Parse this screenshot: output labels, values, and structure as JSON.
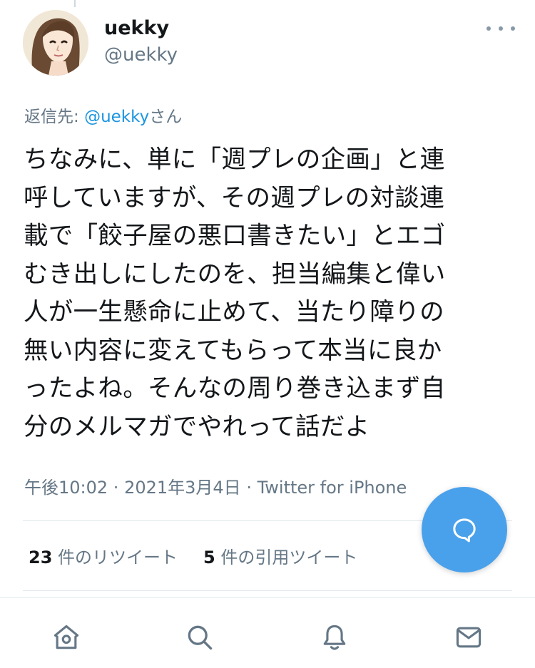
{
  "author": {
    "name": "uekky",
    "handle": "@uekky"
  },
  "more_icon": "more-horizontal-icon",
  "reply_context": {
    "prefix": "返信先: ",
    "mention": "@uekky",
    "suffix": "さん"
  },
  "tweet": {
    "lines": [
      "ちなみに、単に「週プレの企画」と連",
      "呼していますが、その週プレの対談連",
      "載で「餃子屋の悪口書きたい」とエゴ",
      "むき出しにしたのを、担当編集と偉い",
      "人が一生懸命に止めて、当たり障りの",
      "無い内容に変えてもらって本当に良か",
      "ったよね。そんなの周り巻き込まず自",
      "分のメルマガでやれって話だよ"
    ],
    "time": "午後10:02",
    "separator": " · ",
    "date": "2021年3月4日",
    "source": "Twitter for iPhone"
  },
  "stats": {
    "retweets_count": "23",
    "retweets_label": " 件のリツイート",
    "quotes_count": "5",
    "quotes_label": " 件の引用ツイート"
  },
  "fab_icon": "compose-reply-icon",
  "tabbar": {
    "items": [
      "home-icon",
      "search-icon",
      "notifications-icon",
      "messages-icon"
    ]
  },
  "colors": {
    "accent": "#1b95e0",
    "fab": "#4aa1eb",
    "secondary_text": "#657786",
    "icon": "#657786"
  }
}
